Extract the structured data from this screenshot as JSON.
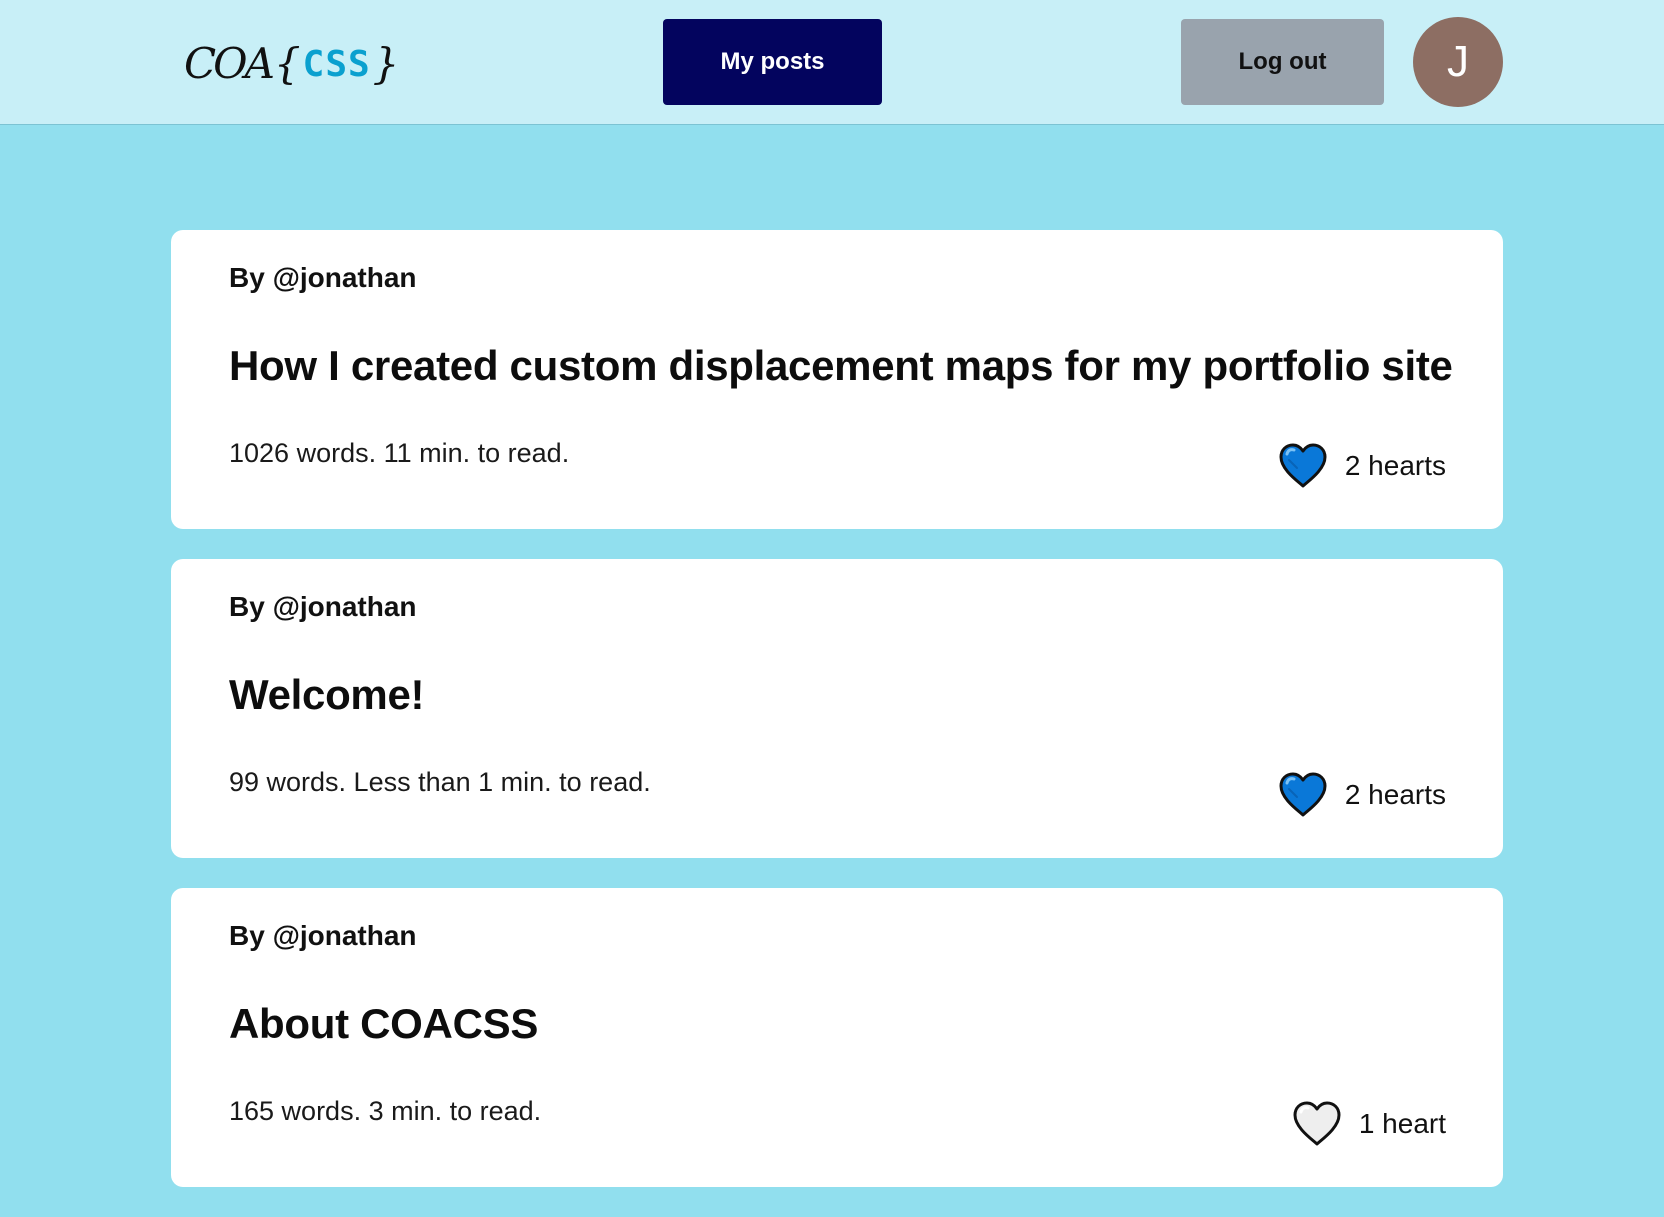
{
  "header": {
    "logo": {
      "part1": "COA",
      "brace_open": "{",
      "part2": "CSS",
      "brace_close": "}"
    },
    "my_posts_label": "My posts",
    "logout_label": "Log out",
    "avatar_initial": "J"
  },
  "colors": {
    "page_bg": "#91dfee",
    "header_bg": "#c8eff7",
    "primary_button": "#03045e",
    "secondary_button": "#99a3ad",
    "avatar_bg": "#8d6e63",
    "heart_filled": "#0a78d8",
    "heart_empty": "#eeeeee"
  },
  "posts": [
    {
      "author": "By @jonathan",
      "title": "How I created custom displacement maps for my portfolio site",
      "stats": "1026 words. 11 min. to read.",
      "hearts_label": "2 hearts",
      "hearted": true,
      "heart_icon": "heart-filled-icon"
    },
    {
      "author": "By @jonathan",
      "title": "Welcome!",
      "stats": "99 words. Less than 1 min. to read.",
      "hearts_label": "2 hearts",
      "hearted": true,
      "heart_icon": "heart-filled-icon"
    },
    {
      "author": "By @jonathan",
      "title": "About COACSS",
      "stats": "165 words. 3 min. to read.",
      "hearts_label": "1 heart",
      "hearted": false,
      "heart_icon": "heart-outline-icon"
    }
  ]
}
